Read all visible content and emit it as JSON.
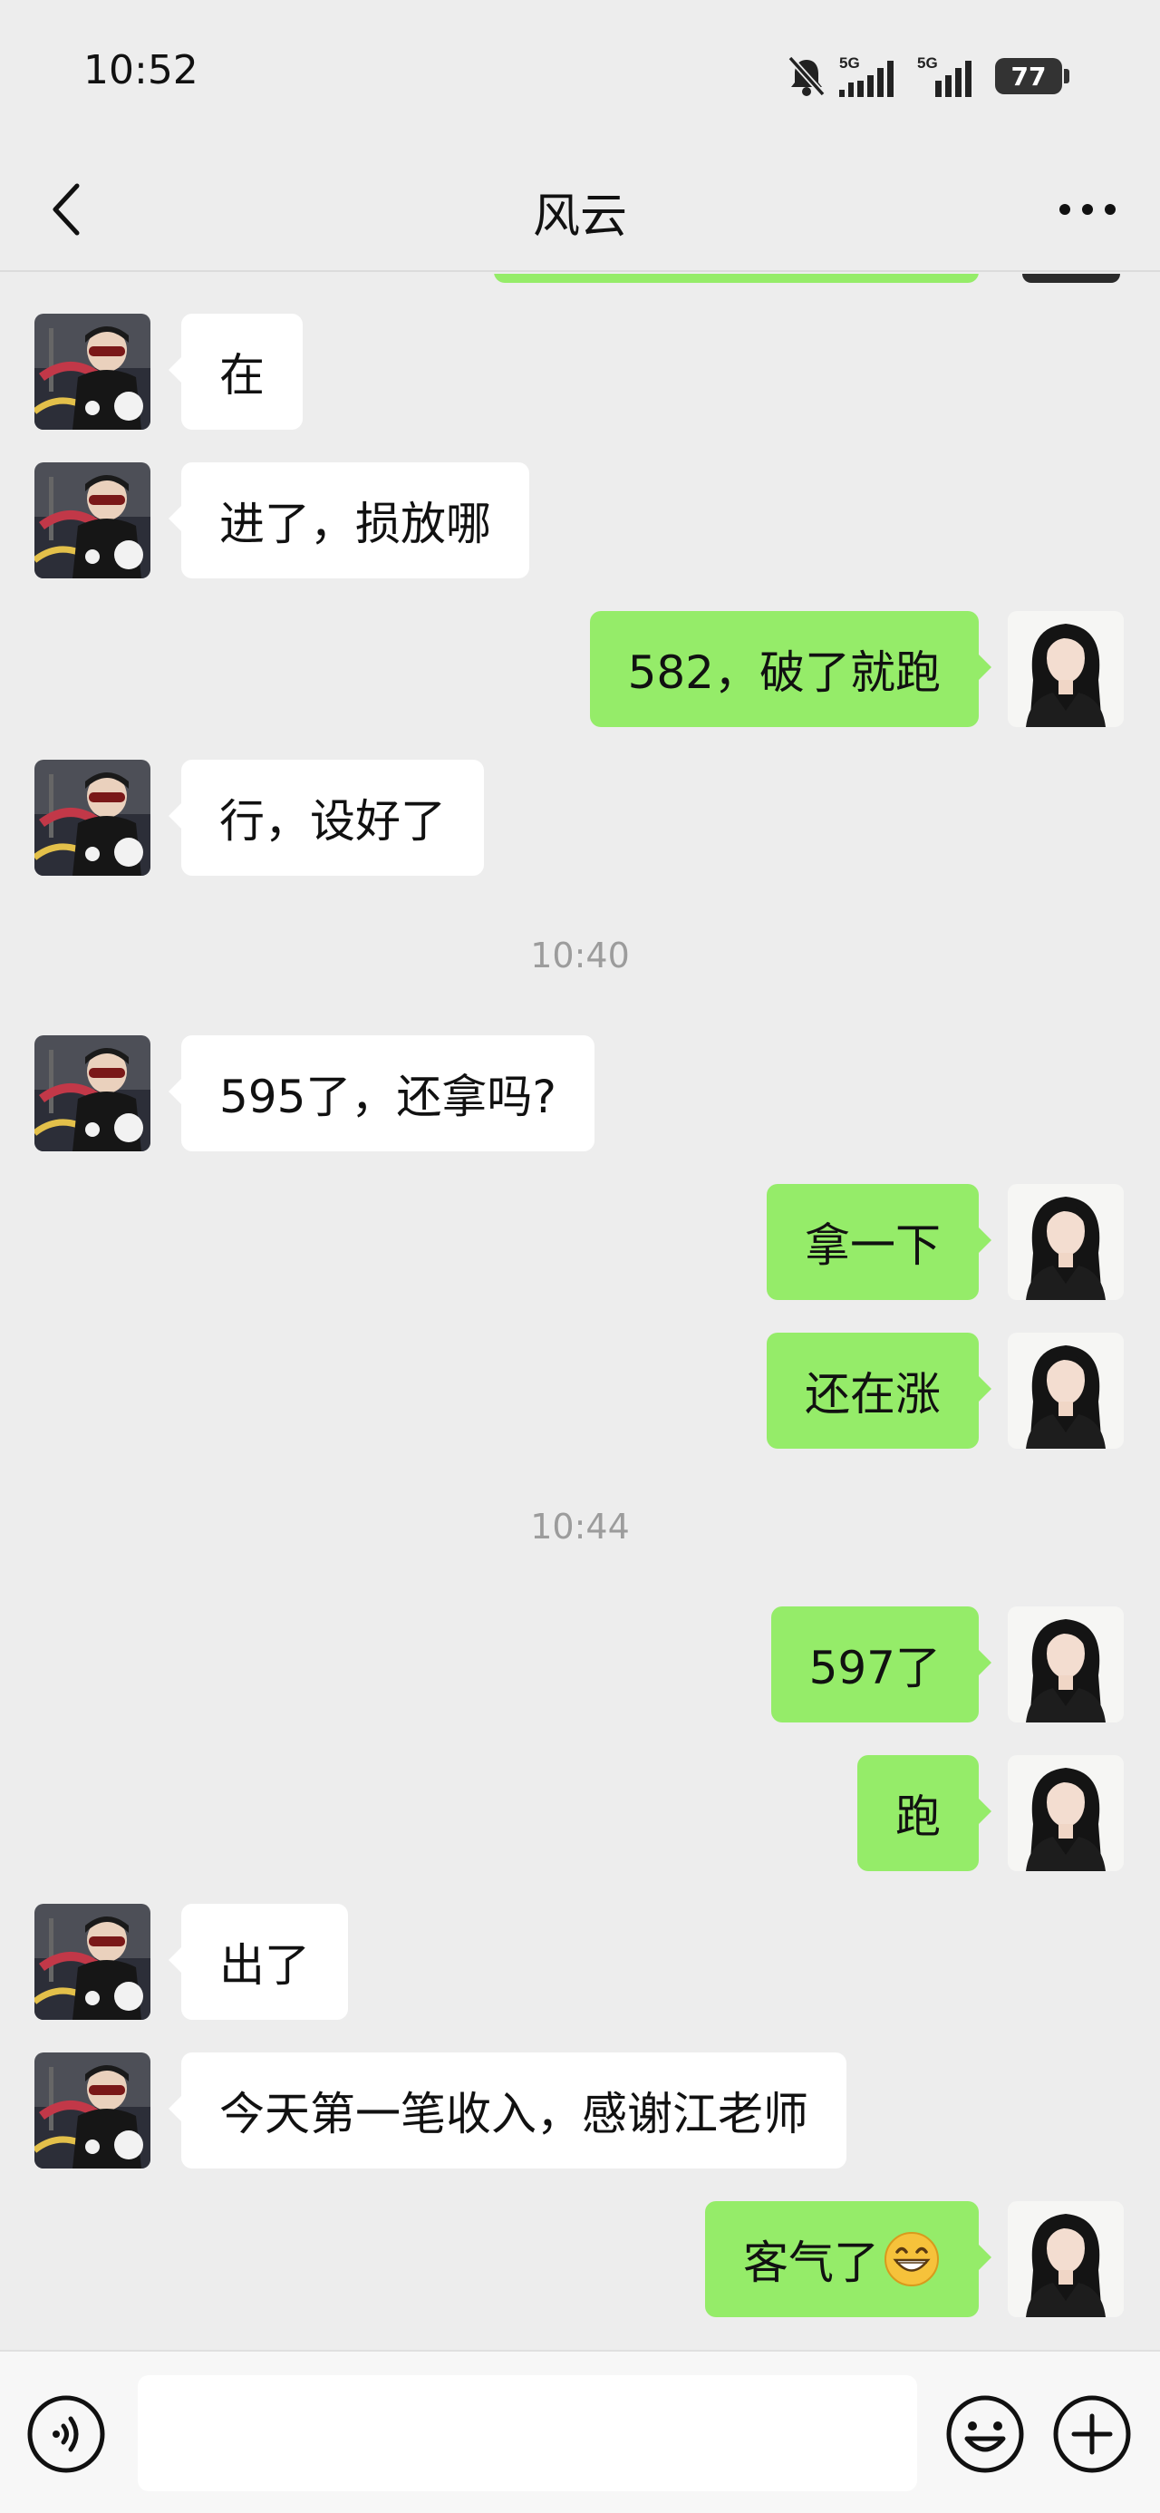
{
  "status_bar": {
    "time": "10:52",
    "network_1": "5G",
    "network_2": "5G",
    "battery": "77",
    "icons": [
      "mute-bell-icon",
      "signal-icon",
      "signal-icon",
      "battery-icon"
    ]
  },
  "nav": {
    "title": "风云",
    "back_icon": "chevron-left-icon",
    "more_icon": "more-dots-icon"
  },
  "messages": [
    {
      "side": "in",
      "text": "在"
    },
    {
      "side": "in",
      "text": "进了，损放哪"
    },
    {
      "side": "out",
      "text": "582，破了就跑"
    },
    {
      "side": "in",
      "text": "行，设好了"
    },
    {
      "type": "time",
      "text": "10:40"
    },
    {
      "side": "in",
      "text": "595了，还拿吗?"
    },
    {
      "side": "out",
      "text": "拿一下"
    },
    {
      "side": "out",
      "text": "还在涨"
    },
    {
      "type": "time",
      "text": "10:44"
    },
    {
      "side": "out",
      "text": "597了"
    },
    {
      "side": "out",
      "text": "跑"
    },
    {
      "side": "in",
      "text": "出了"
    },
    {
      "side": "in",
      "text": "今天第一笔收入，感谢江老师"
    },
    {
      "side": "out",
      "text": "客气了",
      "emoji": "grinning-face-icon"
    }
  ],
  "input_bar": {
    "voice_icon": "voice-icon",
    "emoji_icon": "emoji-icon",
    "plus_icon": "plus-icon",
    "input_value": ""
  },
  "colors": {
    "background": "#ededed",
    "outgoing_bubble": "#95ec69",
    "incoming_bubble": "#ffffff",
    "timestamp": "#9c9c9c"
  }
}
